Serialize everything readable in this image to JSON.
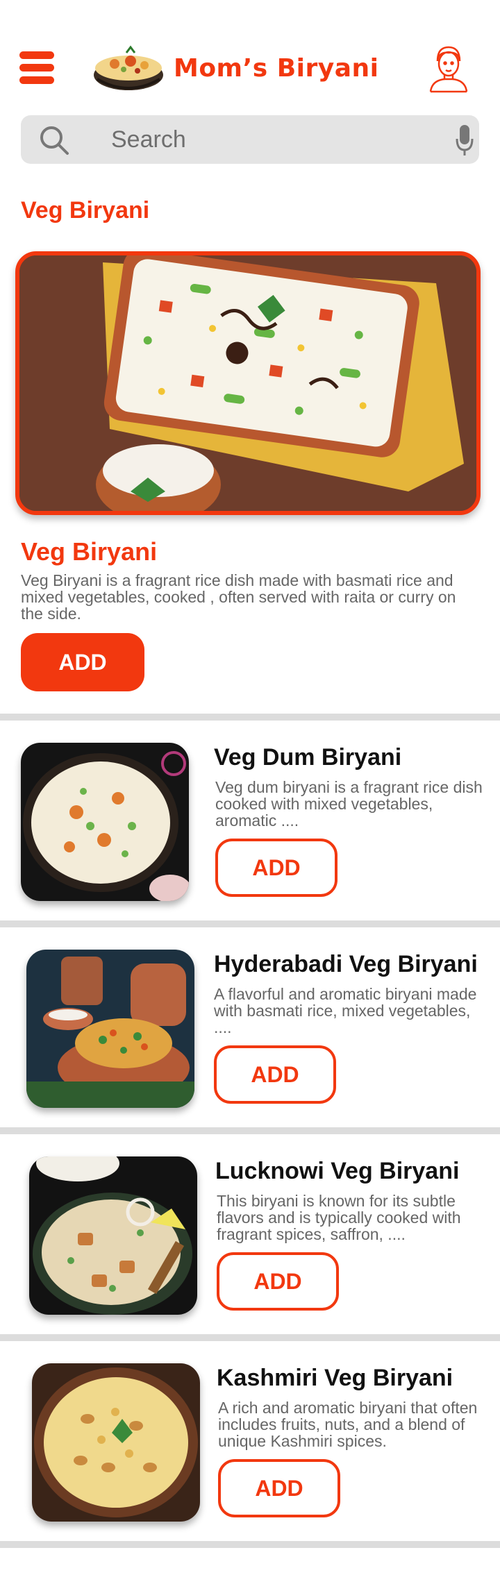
{
  "header": {
    "brand": "Mom’s Biryani",
    "icons": {
      "menu": "hamburger-menu-icon",
      "logo": "biryani-bowl-logo",
      "profile": "user-avatar-icon"
    }
  },
  "search": {
    "placeholder": "Search",
    "value": "",
    "icons": {
      "left": "search-icon",
      "right": "microphone-icon"
    }
  },
  "section": {
    "title": "Veg Biryani"
  },
  "featured": {
    "title": "Veg Biryani",
    "description": "Veg Biryani is a fragrant rice dish made with basmati rice and mixed vegetables, cooked , often served with raita or curry on the side.",
    "add_label": "ADD"
  },
  "items": [
    {
      "title": "Veg Dum Biryani",
      "description": "Veg dum biryani is a fragrant rice dish cooked with mixed vegetables, aromatic ....",
      "add_label": "ADD"
    },
    {
      "title": "Hyderabadi Veg Biryani",
      "description": "A flavorful and aromatic biryani made with basmati rice, mixed vegetables, ....",
      "add_label": "ADD"
    },
    {
      "title": "Lucknowi Veg Biryani",
      "description": "This biryani is known for its subtle flavors and is typically cooked with fragrant spices, saffron, ....",
      "add_label": "ADD"
    },
    {
      "title": "Kashmiri Veg Biryani",
      "description": "A rich and aromatic biryani that often includes fruits, nuts, and a blend of unique Kashmiri spices.",
      "add_label": "ADD"
    }
  ],
  "colors": {
    "accent": "#f2380f",
    "divider": "#dcdcdc",
    "search_bg": "#e4e4e4"
  }
}
